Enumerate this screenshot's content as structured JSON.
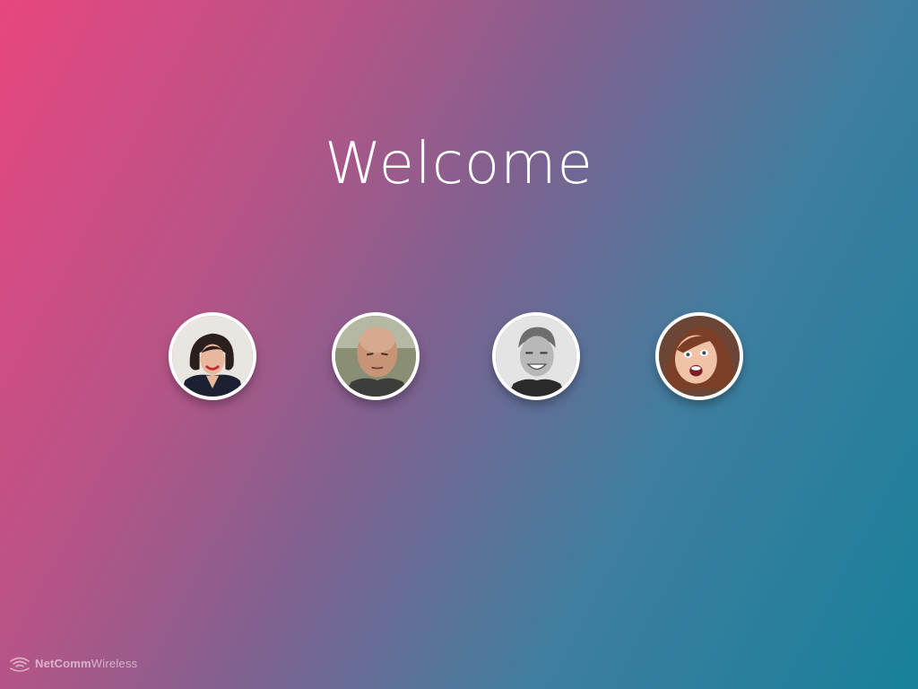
{
  "title": "Welcome",
  "avatars": [
    {
      "id": "user-1",
      "icon": "woman-portrait"
    },
    {
      "id": "user-2",
      "icon": "man-bald-portrait"
    },
    {
      "id": "user-3",
      "icon": "man-smiling-portrait"
    },
    {
      "id": "user-4",
      "icon": "woman-surprised-portrait"
    }
  ],
  "brand": {
    "name_bold": "NetComm",
    "name_light": "Wireless",
    "icon": "wifi-waves-icon"
  },
  "colors": {
    "gradient_start": "#e8467f",
    "gradient_mid": "#7c6290",
    "gradient_end": "#18809a",
    "text": "#ffffff"
  }
}
